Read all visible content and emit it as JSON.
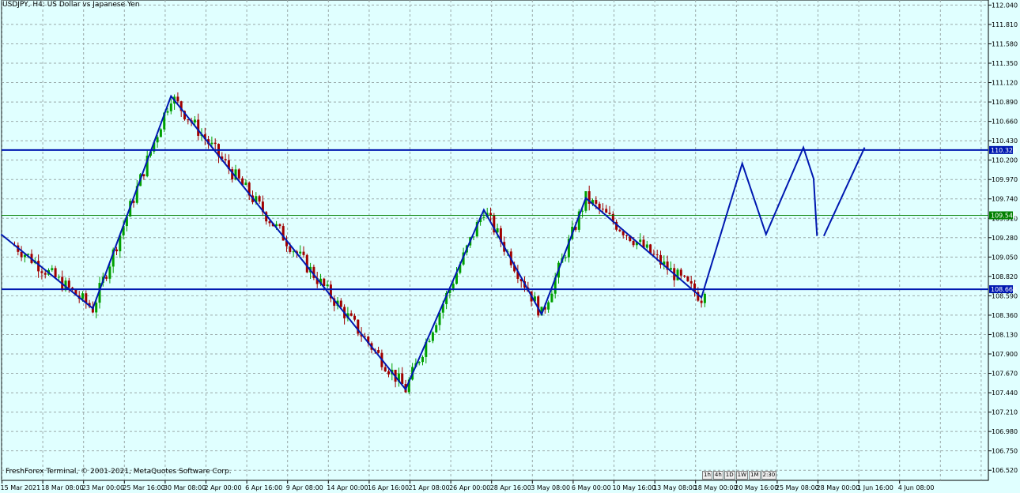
{
  "header": {
    "title": "USDJPY, H4:  US Dollar vs Japanese Yen"
  },
  "footer": {
    "text": "FreshForex Terminal, © 2001-2021, MetaQuotes Software Corp."
  },
  "period_tabs": [
    "1h",
    "4h",
    "1D",
    "1W",
    "1M",
    "2:30"
  ],
  "colors": {
    "background": "#e0ffff",
    "grid": "#9aa9a9",
    "bull": "#00a000",
    "bear": "#a00000",
    "lines": "#0018b0",
    "bid": "#008000"
  },
  "chart_data": {
    "type": "candlestick",
    "symbol": "USDJPY",
    "timeframe": "H4",
    "ylim": [
      106.4,
      112.1
    ],
    "y_ticks": [
      "112.040",
      "111.810",
      "111.580",
      "111.350",
      "111.120",
      "110.890",
      "110.660",
      "110.430",
      "110.200",
      "109.970",
      "109.740",
      "109.510",
      "109.280",
      "109.050",
      "108.820",
      "108.590",
      "108.360",
      "108.130",
      "107.900",
      "107.670",
      "107.440",
      "107.210",
      "106.980",
      "106.750",
      "106.520"
    ],
    "x_ticks": [
      "15 Mar 2021",
      "18 Mar 08:00",
      "23 Mar 00:00",
      "25 Mar 16:00",
      "30 Mar 08:00",
      "2 Apr 00:00",
      "6 Apr 16:00",
      "9 Apr 08:00",
      "14 Apr 00:00",
      "16 Apr 16:00",
      "21 Apr 08:00",
      "26 Apr 00:00",
      "28 Apr 16:00",
      "3 May 08:00",
      "6 May 00:00",
      "10 May 16:00",
      "13 May 08:00",
      "18 May 00:00",
      "20 May 16:00",
      "25 May 08:00",
      "28 May 00:00",
      "1 Jun 16:00",
      "4 Jun 08:00"
    ],
    "candle_count": 204,
    "horizontal_levels": [
      {
        "value": 110.32,
        "label": "110.320"
      },
      {
        "value": 108.668,
        "label": "108.668"
      }
    ],
    "bid": {
      "value": 109.545,
      "label": "109.545"
    },
    "zigzag": [
      {
        "bar": -4,
        "price": 109.32
      },
      {
        "bar": 23,
        "price": 108.44
      },
      {
        "bar": 46,
        "price": 110.96
      },
      {
        "bar": 115,
        "price": 107.48
      },
      {
        "bar": 138,
        "price": 109.61
      },
      {
        "bar": 155,
        "price": 108.37
      },
      {
        "bar": 168,
        "price": 109.75
      },
      {
        "bar": 202,
        "price": 108.57
      },
      {
        "bar": 214,
        "price": 110.16
      },
      {
        "bar": 221,
        "price": 109.32
      },
      {
        "bar": 232,
        "price": 110.35
      },
      {
        "bar": 235,
        "price": 109.98
      },
      {
        "bar": 236,
        "price": 109.3
      }
    ],
    "projection": [
      {
        "bar": 238,
        "price": 109.3
      },
      {
        "bar": 250,
        "price": 110.35
      }
    ]
  }
}
